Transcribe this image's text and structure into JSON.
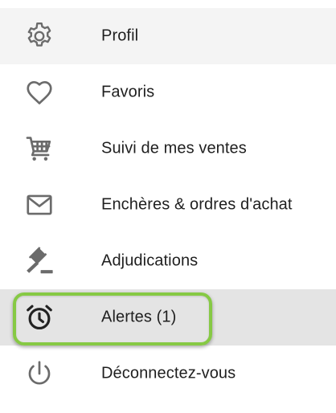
{
  "menu": {
    "items": [
      {
        "label": "Profil",
        "icon": "gear-icon"
      },
      {
        "label": "Favoris",
        "icon": "heart-icon"
      },
      {
        "label": "Suivi de mes ventes",
        "icon": "cart-icon"
      },
      {
        "label": "Enchères & ordres d'achat",
        "icon": "mail-icon"
      },
      {
        "label": "Adjudications",
        "icon": "gavel-icon"
      },
      {
        "label": "Alertes (1)",
        "icon": "alarm-clock-icon"
      },
      {
        "label": "Déconnectez-vous",
        "icon": "power-icon"
      }
    ]
  },
  "colors": {
    "highlight": "#86c944",
    "icon": "#6b6b6b",
    "text": "#1f1f1f",
    "profile_bg": "#f4f4f4",
    "active_bg": "#e4e4e4"
  }
}
